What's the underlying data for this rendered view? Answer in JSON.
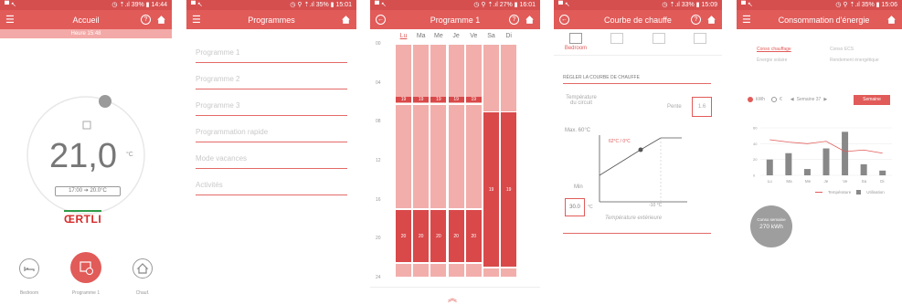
{
  "phone1": {
    "status": {
      "left": "▀ ↖",
      "right": "◷ ⇡.ıl 39% ▮ 14:44"
    },
    "title": "Accueil",
    "subbar": "Heure 15:48",
    "temperature": "21,0",
    "unit": "°C",
    "schedule": "17:00 ➔ 20.0°C",
    "brand": "ŒRTLI",
    "bottom": [
      {
        "label": "Bedroom",
        "icon": "bed-icon"
      },
      {
        "label": "Programme 1",
        "icon": "calendar-clock-icon"
      },
      {
        "label": "Chauf.",
        "icon": "home-icon"
      }
    ]
  },
  "phone2": {
    "status": {
      "left": "▀ ↖",
      "right": "◷ ⚲ ⇡.ıl 35% ▮ 15:01"
    },
    "title": "Programmes",
    "items": [
      "Programme 1",
      "Programme 2",
      "Programme 3",
      "Programmation rapide",
      "Mode vacances",
      "Activités"
    ]
  },
  "phone3": {
    "status": {
      "left": "▀ ↖",
      "right": "◷ ⚲ ⇡.ıl 27% ▮ 16:01"
    },
    "title": "Programme 1",
    "days": [
      "Lu",
      "Ma",
      "Me",
      "Je",
      "Ve",
      "Sa",
      "Di"
    ],
    "hours": [
      "00",
      "04",
      "08",
      "12",
      "16",
      "20",
      "24"
    ],
    "colors": {
      "light": "#f2aeab",
      "dark": "#d9494a",
      "accent": "#e15b59"
    },
    "segments": [
      [
        {
          "from": 0,
          "to": 6.2,
          "temp": "19",
          "dark": false
        },
        {
          "from": 6.2,
          "to": 17,
          "temp": "",
          "dark": false
        },
        {
          "from": 17,
          "to": 22.5,
          "temp": "20",
          "dark": true
        },
        {
          "from": 22.5,
          "to": 24,
          "temp": "",
          "dark": false
        }
      ],
      [
        {
          "from": 0,
          "to": 6.2,
          "temp": "19",
          "dark": false
        },
        {
          "from": 6.2,
          "to": 17,
          "temp": "",
          "dark": false
        },
        {
          "from": 17,
          "to": 22.5,
          "temp": "20",
          "dark": true
        },
        {
          "from": 22.5,
          "to": 24,
          "temp": "",
          "dark": false
        }
      ],
      [
        {
          "from": 0,
          "to": 6.2,
          "temp": "19",
          "dark": false
        },
        {
          "from": 6.2,
          "to": 17,
          "temp": "",
          "dark": false
        },
        {
          "from": 17,
          "to": 22.5,
          "temp": "20",
          "dark": true
        },
        {
          "from": 22.5,
          "to": 24,
          "temp": "",
          "dark": false
        }
      ],
      [
        {
          "from": 0,
          "to": 6.2,
          "temp": "19",
          "dark": false
        },
        {
          "from": 6.2,
          "to": 17,
          "temp": "",
          "dark": false
        },
        {
          "from": 17,
          "to": 22.5,
          "temp": "20",
          "dark": true
        },
        {
          "from": 22.5,
          "to": 24,
          "temp": "",
          "dark": false
        }
      ],
      [
        {
          "from": 0,
          "to": 6.2,
          "temp": "19",
          "dark": false
        },
        {
          "from": 6.2,
          "to": 17,
          "temp": "",
          "dark": false
        },
        {
          "from": 17,
          "to": 22.5,
          "temp": "20",
          "dark": true
        },
        {
          "from": 22.5,
          "to": 24,
          "temp": "",
          "dark": false
        }
      ],
      [
        {
          "from": 0,
          "to": 7,
          "temp": "",
          "dark": false
        },
        {
          "from": 7,
          "to": 23,
          "temp": "19",
          "dark": true
        },
        {
          "from": 23,
          "to": 24,
          "temp": "",
          "dark": false
        }
      ],
      [
        {
          "from": 0,
          "to": 7,
          "temp": "",
          "dark": false
        },
        {
          "from": 7,
          "to": 23,
          "temp": "19",
          "dark": true
        },
        {
          "from": 23,
          "to": 24,
          "temp": "",
          "dark": false
        }
      ]
    ]
  },
  "phone4": {
    "status": {
      "left": "▀ ↖",
      "right": "◷ ⇡.ıl 33% ▮ 15:09"
    },
    "title": "Courbe de chauffe",
    "tabs": [
      "Bedroom",
      "",
      "",
      ""
    ],
    "heading": "RÉGLER LA COURBE DE CHAUFFE",
    "temp_circuit": "Température du circuit",
    "pente_label": "Pente",
    "pente_value": "1.6",
    "max_label": "Max. 60°C",
    "point_label": "62°C / 0°C",
    "x_point": "-10 °C",
    "min_label": "Min",
    "min_value": "30.0",
    "min_unit": "°C",
    "x_axis": "Température extérieure"
  },
  "phone5": {
    "status": {
      "left": "▀ ↖",
      "right": "◷ ⚲ ⇡.ıl 35% ▮ 15:06"
    },
    "title": "Consommation d'énergie",
    "tabs": [
      "Conso chauffage",
      "Conso ECS",
      "Énergie solaire",
      "Rendement énergétique"
    ],
    "units": [
      "kWh",
      "€"
    ],
    "week": "Semaine 37",
    "mode": "Semaine",
    "total_label": "Conso semaine",
    "total_value": "270 kWh",
    "chart_data": {
      "type": "bar",
      "categories": [
        "Lu",
        "Ma",
        "Me",
        "Je",
        "Ve",
        "Sa",
        "Di"
      ],
      "series": [
        {
          "name": "Utilisation",
          "values": [
            20,
            28,
            8,
            34,
            55,
            14,
            6
          ]
        },
        {
          "name": "Température",
          "values": [
            45,
            42,
            40,
            43,
            30,
            32,
            28
          ]
        }
      ],
      "ylim": [
        0,
        60
      ],
      "yticks": [
        "60",
        "40",
        "20",
        "0"
      ],
      "colors": {
        "bars": "#888888",
        "line": "#e15b59"
      }
    }
  }
}
